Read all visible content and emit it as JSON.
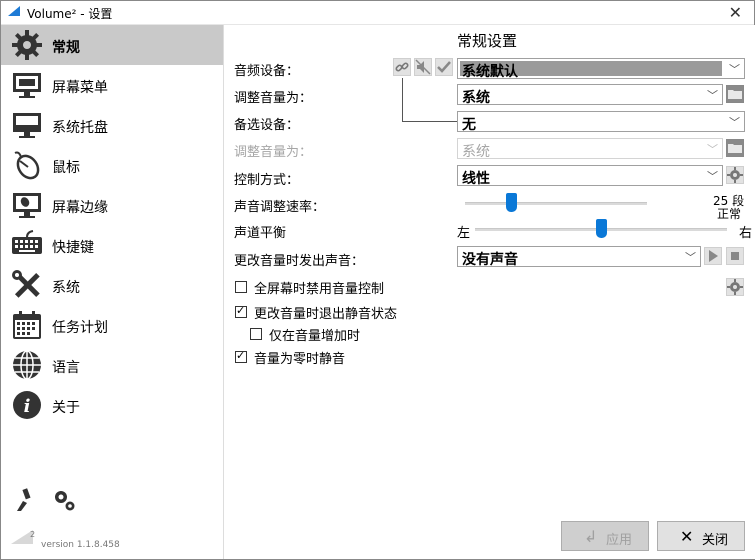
{
  "window": {
    "title": "Volume² - 设置"
  },
  "sidebar": {
    "items": [
      {
        "label": "常规",
        "icon": "gear-icon",
        "active": true
      },
      {
        "label": "屏幕菜单",
        "icon": "monitor-menu-icon"
      },
      {
        "label": "系统托盘",
        "icon": "monitor-tray-icon"
      },
      {
        "label": "鼠标",
        "icon": "mouse-icon"
      },
      {
        "label": "屏幕边缘",
        "icon": "monitor-edge-icon"
      },
      {
        "label": "快捷键",
        "icon": "keyboard-icon"
      },
      {
        "label": "系统",
        "icon": "tools-icon"
      },
      {
        "label": "任务计划",
        "icon": "calendar-icon"
      },
      {
        "label": "语言",
        "icon": "globe-icon"
      },
      {
        "label": "关于",
        "icon": "info-icon"
      }
    ],
    "version": "version 1.1.8.458",
    "version_badge": "2"
  },
  "main": {
    "section_title": "常规设置",
    "audio_device": {
      "label": "音频设备：",
      "value": "系统默认"
    },
    "adjust_volume_for": {
      "label": "调整音量为：",
      "value": "系统"
    },
    "alt_device": {
      "label": "备选设备：",
      "value": "无"
    },
    "adjust_volume_for_2": {
      "label": "调整音量为：",
      "value": "系统"
    },
    "control_mode": {
      "label": "控制方式：",
      "value": "线性"
    },
    "adjust_speed": {
      "label": "声音调整速率：",
      "right_value": "25 段",
      "right_caption": "正常",
      "level": 0.25
    },
    "balance": {
      "label": "声道平衡",
      "left": "左",
      "right": "右",
      "level": 0.5
    },
    "change_sound": {
      "label": "更改音量时发出声音：",
      "value": "没有声音"
    },
    "checkboxes": [
      {
        "label": "全屏幕时禁用音量控制",
        "checked": false
      },
      {
        "label": "更改音量时退出静音状态",
        "checked": true
      },
      {
        "label": "仅在音量增加时",
        "checked": false
      },
      {
        "label": "音量为零时静音",
        "checked": true
      }
    ]
  },
  "footer": {
    "apply_label": "应用",
    "close_label": "关闭"
  }
}
